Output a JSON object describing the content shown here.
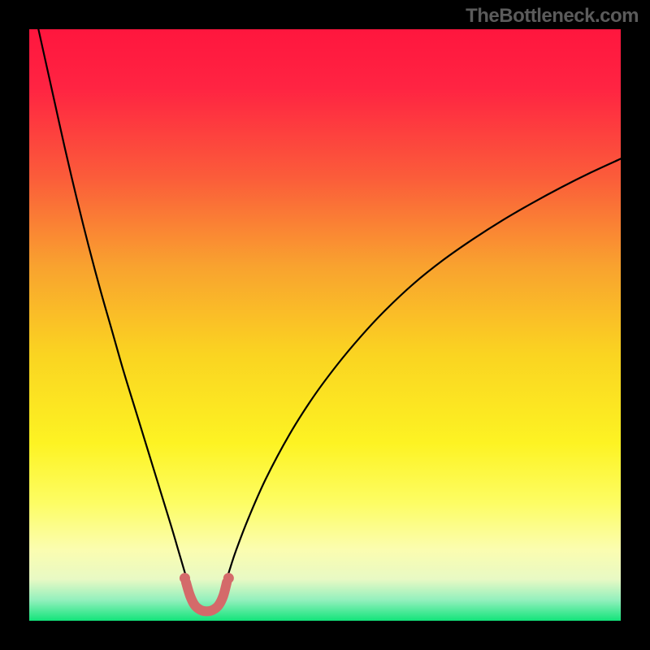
{
  "watermark": "TheBottleneck.com",
  "chart_data": {
    "type": "line",
    "title": "",
    "xlabel": "",
    "ylabel": "",
    "xlim": [
      0,
      100
    ],
    "ylim": [
      0,
      100
    ],
    "gradient_stops": [
      {
        "offset": 0.0,
        "color": "#ff163e"
      },
      {
        "offset": 0.1,
        "color": "#ff2442"
      },
      {
        "offset": 0.25,
        "color": "#fb5c3a"
      },
      {
        "offset": 0.4,
        "color": "#f9a22f"
      },
      {
        "offset": 0.55,
        "color": "#fad421"
      },
      {
        "offset": 0.7,
        "color": "#fdf323"
      },
      {
        "offset": 0.8,
        "color": "#fdfd63"
      },
      {
        "offset": 0.88,
        "color": "#fbfdb0"
      },
      {
        "offset": 0.93,
        "color": "#e8f9c4"
      },
      {
        "offset": 0.965,
        "color": "#93f0bd"
      },
      {
        "offset": 1.0,
        "color": "#12e47a"
      }
    ],
    "series": [
      {
        "name": "left-curve",
        "stroke": "#000000",
        "stroke_width": 2.2,
        "x": [
          0,
          2,
          4,
          6,
          8,
          10,
          12,
          14,
          16,
          18,
          20,
          22,
          24,
          25,
          26,
          27
        ],
        "y": [
          107,
          98,
          89,
          80,
          71.5,
          63.5,
          56,
          49,
          42,
          35.5,
          29,
          22.5,
          16,
          12.6,
          9.2,
          5.8
        ]
      },
      {
        "name": "right-curve",
        "stroke": "#000000",
        "stroke_width": 2.2,
        "x": [
          33,
          34,
          35,
          37,
          40,
          44,
          48,
          52,
          56,
          60,
          65,
          70,
          75,
          80,
          85,
          90,
          95,
          100
        ],
        "y": [
          5.8,
          9,
          12,
          17.2,
          24,
          31.5,
          37.8,
          43.2,
          48,
          52.3,
          57,
          61,
          64.5,
          67.7,
          70.6,
          73.3,
          75.8,
          78.1
        ]
      },
      {
        "name": "bottom-arc",
        "stroke": "#d46a6a",
        "stroke_width": 12,
        "x": [
          26.5,
          27.2,
          28,
          29,
          30,
          31,
          32,
          32.8,
          33.4
        ],
        "y": [
          6.5,
          4.2,
          2.6,
          1.8,
          1.6,
          1.8,
          2.6,
          4.2,
          6.5
        ]
      }
    ],
    "bottom_dots": {
      "color": "#d46a6a",
      "radius": 6.5,
      "points": [
        {
          "x": 26.3,
          "y": 7.2
        },
        {
          "x": 33.7,
          "y": 7.2
        }
      ]
    }
  }
}
